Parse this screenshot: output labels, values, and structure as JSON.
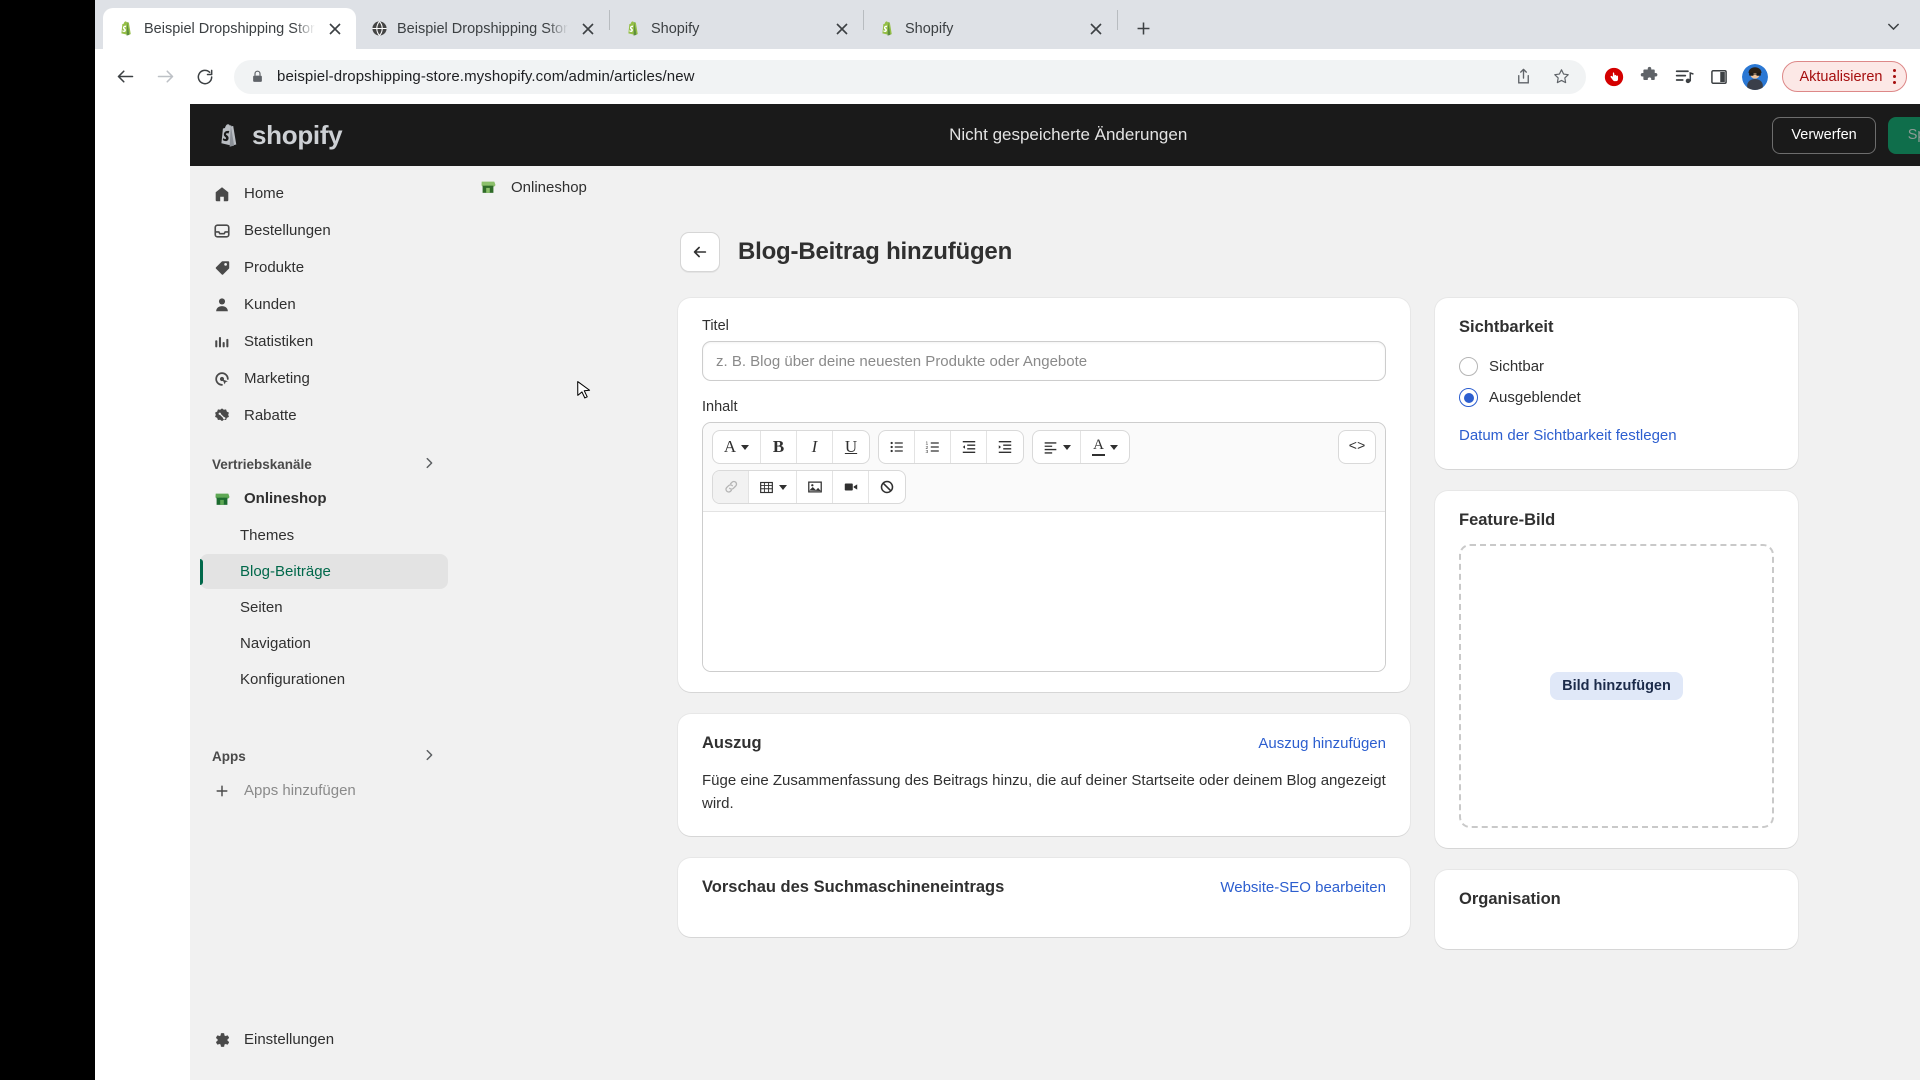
{
  "browser": {
    "tabs": [
      {
        "title": "Beispiel Dropshipping Store · B",
        "favicon": "shopify-icon",
        "active": true
      },
      {
        "title": "Beispiel Dropshipping Store",
        "favicon": "globe-icon",
        "active": false
      },
      {
        "title": "Shopify",
        "favicon": "shopify-icon",
        "active": false
      },
      {
        "title": "Shopify",
        "favicon": "shopify-icon",
        "active": false
      }
    ],
    "new_tab_label": "+",
    "url": "beispiel-dropshipping-store.myshopify.com/admin/articles/new",
    "update_button": "Aktualisieren",
    "nav": {
      "back": "back-icon",
      "forward": "forward-icon",
      "reload": "reload-icon"
    },
    "toolbar_icons": [
      "share-icon",
      "bookmark-star-icon",
      "adblock-icon",
      "extensions-puzzle-icon",
      "reading-list-icon",
      "side-panel-icon",
      "profile-avatar"
    ]
  },
  "topbar": {
    "brand": "shopify",
    "unsaved_text": "Nicht gespeicherte Änderungen",
    "discard_label": "Verwerfen",
    "save_label": "Speichern"
  },
  "sidebar": {
    "items": [
      {
        "label": "Home",
        "icon": "home-icon"
      },
      {
        "label": "Bestellungen",
        "icon": "orders-inbox-icon"
      },
      {
        "label": "Produkte",
        "icon": "product-tag-icon"
      },
      {
        "label": "Kunden",
        "icon": "customer-person-icon"
      },
      {
        "label": "Statistiken",
        "icon": "analytics-bars-icon"
      },
      {
        "label": "Marketing",
        "icon": "marketing-target-icon"
      },
      {
        "label": "Rabatte",
        "icon": "discount-percent-icon"
      }
    ],
    "channels_section": "Vertriebskanäle",
    "online_store": {
      "label": "Onlineshop",
      "icon": "storefront-icon"
    },
    "sub_items": [
      {
        "label": "Themes",
        "active": false
      },
      {
        "label": "Blog-Beiträge",
        "active": true
      },
      {
        "label": "Seiten",
        "active": false
      },
      {
        "label": "Navigation",
        "active": false
      },
      {
        "label": "Konfigurationen",
        "active": false
      }
    ],
    "apps_section": "Apps",
    "add_apps": "Apps hinzufügen",
    "settings": "Einstellungen"
  },
  "context_bar": {
    "store_label": "Onlineshop",
    "pin_icon": "pin-icon",
    "more_icon": "more-dots-icon"
  },
  "page": {
    "title": "Blog-Beitrag hinzufügen",
    "back_icon": "arrow-left-icon"
  },
  "content_card": {
    "title_label": "Titel",
    "title_placeholder": "z. B. Blog über deine neuesten Produkte oder Angebote",
    "title_value": "",
    "content_label": "Inhalt",
    "toolbar_row1": [
      {
        "name": "font-style-button",
        "glyph": "A",
        "caret": true
      },
      {
        "name": "bold-button",
        "glyph": "B"
      },
      {
        "name": "italic-button",
        "glyph": "I"
      },
      {
        "name": "underline-button",
        "glyph": "U"
      },
      {
        "name": "bullet-list-button",
        "glyph": "bullet-list-icon"
      },
      {
        "name": "numbered-list-button",
        "glyph": "numbered-list-icon"
      },
      {
        "name": "outdent-button",
        "glyph": "outdent-icon"
      },
      {
        "name": "indent-button",
        "glyph": "indent-icon"
      },
      {
        "name": "align-button",
        "glyph": "align-left-icon",
        "caret": true
      },
      {
        "name": "text-color-button",
        "glyph": "A",
        "caret": true
      },
      {
        "name": "html-code-button",
        "glyph": "<>"
      }
    ],
    "toolbar_row2": [
      {
        "name": "insert-link-button",
        "glyph": "link-icon",
        "disabled": true
      },
      {
        "name": "insert-table-button",
        "glyph": "table-icon",
        "caret": true
      },
      {
        "name": "insert-image-button",
        "glyph": "image-icon"
      },
      {
        "name": "insert-video-button",
        "glyph": "video-icon"
      },
      {
        "name": "clear-formatting-button",
        "glyph": "no-symbol-icon"
      }
    ],
    "editor_value": ""
  },
  "excerpt_card": {
    "title": "Auszug",
    "link": "Auszug hinzufügen",
    "body": "Füge eine Zusammenfassung des Beitrags hinzu, die auf deiner Startseite oder deinem Blog angezeigt wird."
  },
  "seo_card": {
    "title": "Vorschau des Suchmaschineneintrags",
    "link": "Website-SEO bearbeiten"
  },
  "visibility_card": {
    "title": "Sichtbarkeit",
    "options": [
      {
        "label": "Sichtbar",
        "selected": false
      },
      {
        "label": "Ausgeblendet",
        "selected": true
      }
    ],
    "link": "Datum der Sichtbarkeit festlegen"
  },
  "feature_image_card": {
    "title": "Feature-Bild",
    "add_button": "Bild hinzufügen"
  },
  "organisation_card": {
    "title": "Organisation"
  },
  "colors": {
    "shopify_green": "#00684a",
    "save_button": "#0f6e4b",
    "link_blue": "#2c5ecf",
    "topbar_black": "#1a1a1a",
    "app_bg": "#f1f1f1",
    "update_red": "#a50e0e"
  }
}
